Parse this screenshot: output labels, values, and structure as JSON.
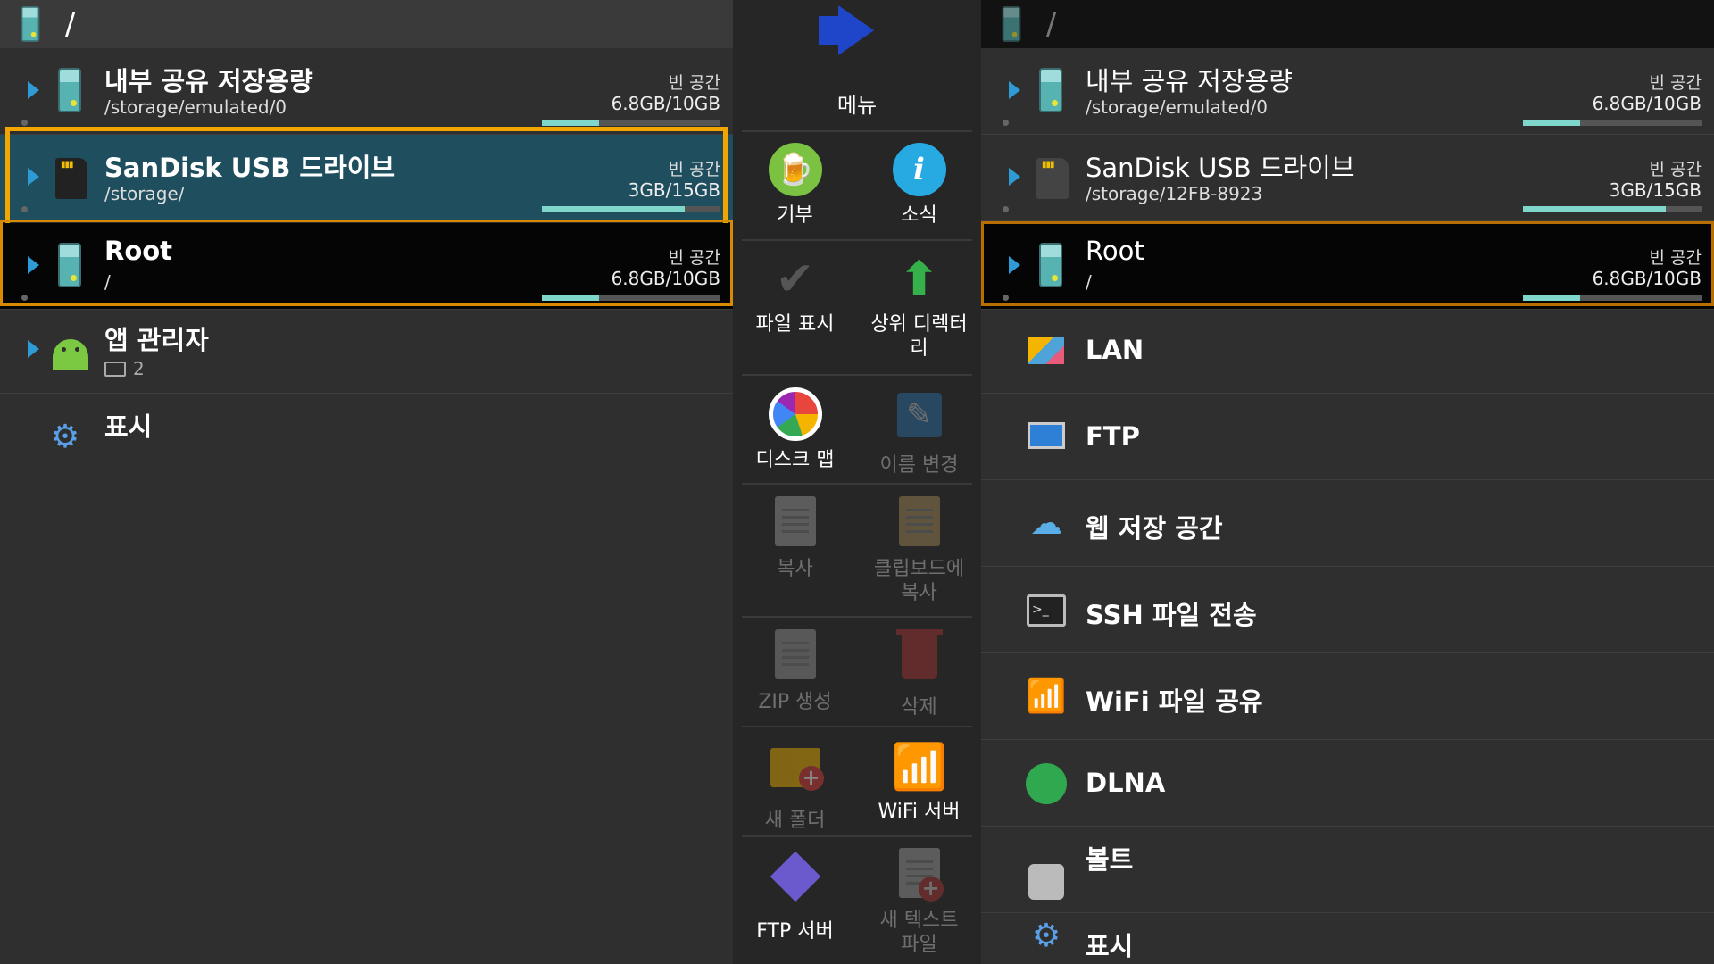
{
  "left": {
    "path": "/",
    "rows": [
      {
        "title": "내부 공유 저장용량",
        "path": "/storage/emulated/0",
        "free_label": "빈 공간",
        "free": "6.8GB/10GB",
        "used_fraction": 0.32
      },
      {
        "title": "SanDisk USB 드라이브",
        "path": "/storage/",
        "free_label": "빈 공간",
        "free": "3GB/15GB",
        "used_fraction": 0.8
      },
      {
        "title": "Root",
        "path": "/",
        "free_label": "빈 공간",
        "free": "6.8GB/10GB",
        "used_fraction": 0.32
      },
      {
        "title": "앱 관리자",
        "count": "2"
      },
      {
        "title": "표시"
      }
    ]
  },
  "menu": {
    "title": "메뉴",
    "items": [
      {
        "label": "기부",
        "icon": "beer-badge-icon"
      },
      {
        "label": "소식",
        "icon": "info-badge-icon"
      },
      {
        "label": "파일 표시",
        "icon": "checkmark-icon"
      },
      {
        "label": "상위 디렉터리",
        "icon": "up-arrow-icon"
      },
      {
        "label": "디스크 맵",
        "icon": "disk-map-icon"
      },
      {
        "label": "이름 변경",
        "icon": "rename-icon"
      },
      {
        "label": "복사",
        "icon": "copy-icon"
      },
      {
        "label": "클립보드에 복사",
        "icon": "clipboard-icon"
      },
      {
        "label": "ZIP 생성",
        "icon": "zip-icon"
      },
      {
        "label": "삭제",
        "icon": "trash-icon"
      },
      {
        "label": "새 폴더",
        "icon": "new-folder-icon"
      },
      {
        "label": "WiFi 서버",
        "icon": "wifi-icon"
      },
      {
        "label": "FTP 서버",
        "icon": "ftp-server-icon"
      },
      {
        "label": "새 텍스트 파일",
        "icon": "new-text-file-icon"
      }
    ]
  },
  "right": {
    "path": "/",
    "rows": [
      {
        "title": "내부 공유 저장용량",
        "path": "/storage/emulated/0",
        "free_label": "빈 공간",
        "free": "6.8GB/10GB",
        "used_fraction": 0.32
      },
      {
        "title": "SanDisk USB 드라이브",
        "path": "/storage/12FB-8923",
        "free_label": "빈 공간",
        "free": "3GB/15GB",
        "used_fraction": 0.8
      },
      {
        "title": "Root",
        "path": "/",
        "free_label": "빈 공간",
        "free": "6.8GB/10GB",
        "used_fraction": 0.32
      },
      {
        "title": "LAN",
        "icon": "lan-icon"
      },
      {
        "title": "FTP",
        "icon": "monitor-icon"
      },
      {
        "title": "웹 저장 공간",
        "icon": "cloud-icon"
      },
      {
        "title": "SSH 파일 전송",
        "icon": "terminal-lock-icon"
      },
      {
        "title": "WiFi 파일 공유",
        "icon": "wifi-icon"
      },
      {
        "title": "DLNA",
        "icon": "dlna-icon"
      },
      {
        "title": "볼트",
        "icon": "vault-icon"
      },
      {
        "title": "표시",
        "icon": "gears-icon"
      }
    ]
  },
  "colors": {
    "accent": "#f0a500",
    "selected_blue": "#1f4f5f",
    "bar_fill": "#7fd6cb",
    "arrow_blue": "#2e9bd6"
  }
}
